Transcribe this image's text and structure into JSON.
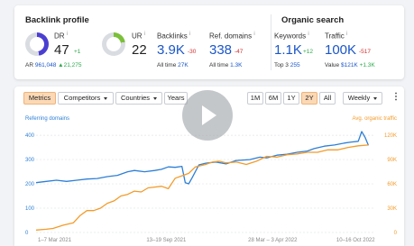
{
  "backlink_profile": {
    "title": "Backlink profile",
    "dr": {
      "label": "DR",
      "info": "i",
      "value": "47",
      "delta": "+1",
      "fill_percent": 47,
      "color": "#4b3fd1"
    },
    "ar": {
      "label": "AR",
      "value": "961,048",
      "delta": "▲21,275"
    },
    "ur": {
      "label": "UR",
      "info": "i",
      "value": "22",
      "fill_percent": 22,
      "color": "#7bbf3a"
    },
    "backlinks": {
      "label": "Backlinks",
      "info": "i",
      "value": "3.9K",
      "delta": "-30",
      "sub_label": "All time",
      "sub_value": "27K"
    },
    "ref_domains": {
      "label": "Ref. domains",
      "info": "i",
      "value": "338",
      "delta": "-47",
      "sub_label": "All time",
      "sub_value": "1.3K"
    }
  },
  "organic_search": {
    "title": "Organic search",
    "keywords": {
      "label": "Keywords",
      "info": "i",
      "value": "1.1K",
      "delta": "+12",
      "sub_label": "Top 3",
      "sub_value": "255"
    },
    "traffic": {
      "label": "Traffic",
      "info": "i",
      "value": "100K",
      "delta": "-517",
      "sub_label": "Value",
      "sub_value": "$121K",
      "sub_delta": "+1.3K"
    }
  },
  "toolbar": {
    "metrics": "Metrics",
    "competitors": "Competitors",
    "countries": "Countries",
    "years": "Years",
    "ranges": [
      "1M",
      "6M",
      "1Y",
      "2Y",
      "All"
    ],
    "active_range": "2Y",
    "interval": "Weekly",
    "more": "⋮"
  },
  "colors": {
    "referring_domains": "#2d7fd6",
    "organic_traffic": "#f39b2a"
  },
  "chart_data": {
    "type": "line",
    "x_tick_labels": [
      "1–7 Mar 2021",
      "13–19 Sep 2021",
      "28 Mar – 3 Apr 2022",
      "10–16 Oct 2022"
    ],
    "y_left": {
      "label": "Referring domains",
      "ticks": [
        "400",
        "300",
        "200",
        "100",
        "0"
      ],
      "range": [
        0,
        430
      ]
    },
    "y_right": {
      "label": "Avg. organic traffic",
      "ticks": [
        "120K",
        "90K",
        "60K",
        "30K",
        "0"
      ],
      "range": [
        0,
        129000
      ]
    },
    "series": [
      {
        "name": "Referring domains",
        "axis": "left",
        "points": [
          [
            0,
            205
          ],
          [
            3,
            210
          ],
          [
            6,
            215
          ],
          [
            9,
            210
          ],
          [
            12,
            215
          ],
          [
            15,
            220
          ],
          [
            18,
            222
          ],
          [
            21,
            230
          ],
          [
            24,
            235
          ],
          [
            27,
            250
          ],
          [
            29,
            255
          ],
          [
            32,
            250
          ],
          [
            35,
            255
          ],
          [
            37,
            260
          ],
          [
            39,
            270
          ],
          [
            41,
            268
          ],
          [
            43,
            272
          ],
          [
            44,
            205
          ],
          [
            45,
            200
          ],
          [
            46,
            225
          ],
          [
            48,
            278
          ],
          [
            50,
            285
          ],
          [
            53,
            290
          ],
          [
            56,
            282
          ],
          [
            59,
            296
          ],
          [
            61,
            298
          ],
          [
            63,
            300
          ],
          [
            66,
            310
          ],
          [
            68,
            307
          ],
          [
            71,
            318
          ],
          [
            74,
            322
          ],
          [
            77,
            330
          ],
          [
            80,
            335
          ],
          [
            82,
            345
          ],
          [
            85,
            355
          ],
          [
            88,
            360
          ],
          [
            91,
            368
          ],
          [
            93,
            372
          ],
          [
            95,
            375
          ],
          [
            96,
            415
          ],
          [
            97,
            392
          ],
          [
            98,
            358
          ]
        ]
      },
      {
        "name": "Avg. organic traffic",
        "axis": "right",
        "points": [
          [
            0,
            3000
          ],
          [
            3,
            4000
          ],
          [
            5,
            5000
          ],
          [
            8,
            9000
          ],
          [
            11,
            12000
          ],
          [
            13,
            21000
          ],
          [
            15,
            27000
          ],
          [
            17,
            27000
          ],
          [
            19,
            30000
          ],
          [
            21,
            36000
          ],
          [
            23,
            39000
          ],
          [
            25,
            45000
          ],
          [
            27,
            47000
          ],
          [
            29,
            51000
          ],
          [
            31,
            50000
          ],
          [
            33,
            55000
          ],
          [
            35,
            56000
          ],
          [
            37,
            57000
          ],
          [
            39,
            54000
          ],
          [
            41,
            67000
          ],
          [
            43,
            70000
          ],
          [
            45,
            73000
          ],
          [
            47,
            81000
          ],
          [
            50,
            84000
          ],
          [
            52,
            87000
          ],
          [
            54,
            88000
          ],
          [
            56,
            86000
          ],
          [
            59,
            87000
          ],
          [
            62,
            84000
          ],
          [
            65,
            88000
          ],
          [
            68,
            94000
          ],
          [
            71,
            93000
          ],
          [
            74,
            96000
          ],
          [
            77,
            97000
          ],
          [
            80,
            99000
          ],
          [
            83,
            99000
          ],
          [
            86,
            102000
          ],
          [
            89,
            102000
          ],
          [
            92,
            105000
          ],
          [
            95,
            107000
          ],
          [
            98,
            108000
          ]
        ]
      }
    ],
    "grid": "horizontal dashed",
    "legend": "top-left and top-right axis titles"
  }
}
